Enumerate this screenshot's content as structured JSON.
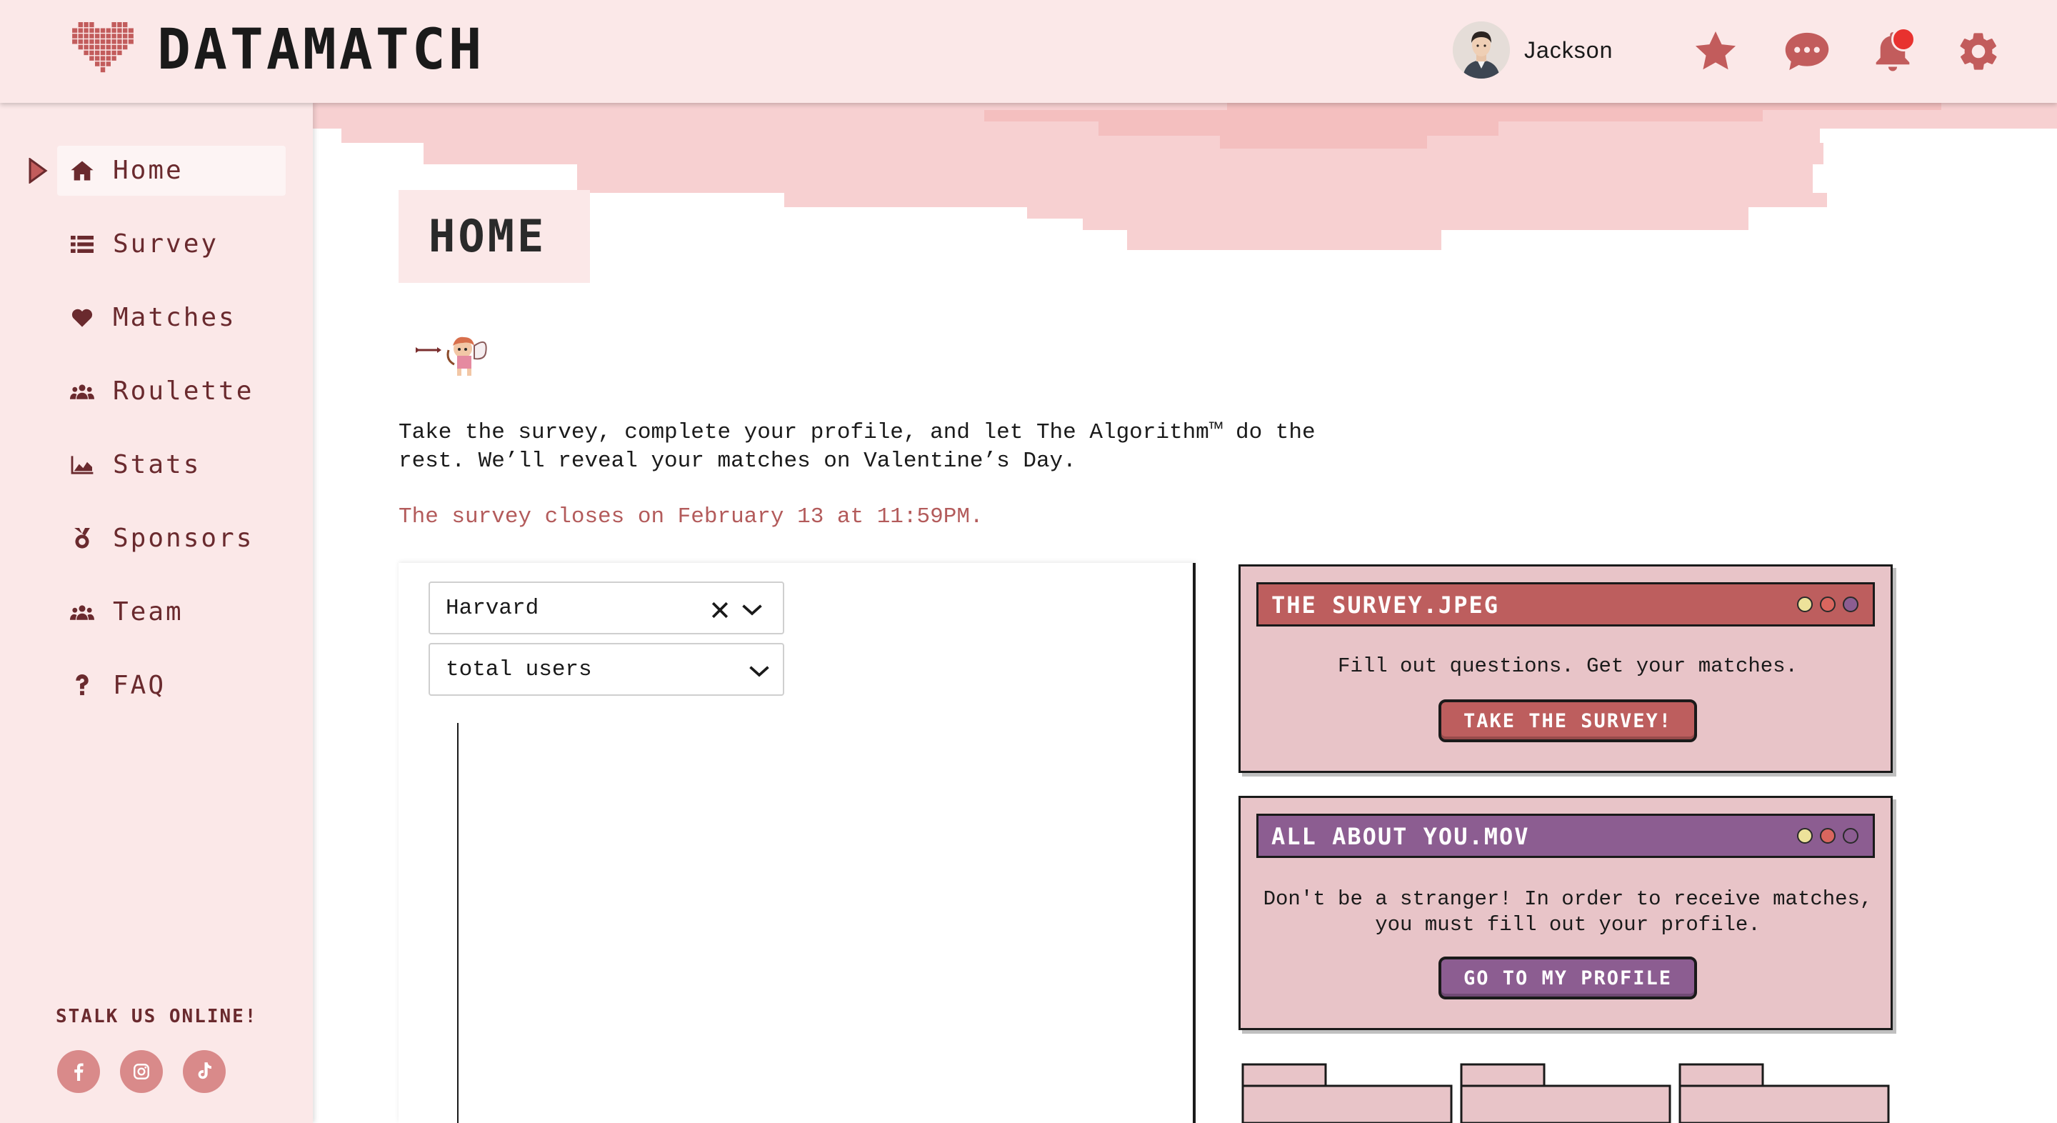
{
  "app": {
    "name": "DATAMATCH"
  },
  "header": {
    "user_name": "Jackson",
    "icons": [
      "star-icon",
      "chat-icon",
      "bell-icon",
      "gear-icon"
    ],
    "has_notification": true
  },
  "sidebar": {
    "items": [
      {
        "label": "Home",
        "icon": "home-icon",
        "active": true
      },
      {
        "label": "Survey",
        "icon": "list-icon",
        "active": false
      },
      {
        "label": "Matches",
        "icon": "heart-icon",
        "active": false
      },
      {
        "label": "Roulette",
        "icon": "users-icon",
        "active": false
      },
      {
        "label": "Stats",
        "icon": "area-chart-icon",
        "active": false
      },
      {
        "label": "Sponsors",
        "icon": "medal-icon",
        "active": false
      },
      {
        "label": "Team",
        "icon": "users-icon",
        "active": false
      },
      {
        "label": "FAQ",
        "icon": "question-icon",
        "active": false
      }
    ],
    "stalk_label": "STALK US ONLINE!",
    "socials": [
      "facebook-icon",
      "instagram-icon",
      "tiktok-icon"
    ]
  },
  "main": {
    "page_title": "HOME",
    "intro_line1": "Take the survey, complete your profile, and let The Algorithm™ do the",
    "intro_line2": "rest. We’ll reveal your matches on Valentine’s Day.",
    "closes_text": "The survey closes on February 13 at 11:59PM.",
    "school_select": {
      "value": "Harvard"
    },
    "metric_select": {
      "value": "total users"
    }
  },
  "windows": [
    {
      "title": "THE SURVEY.JPEG",
      "text": "Fill out questions. Get your matches.",
      "button": "TAKE THE SURVEY!",
      "color": "#bd5e5e"
    },
    {
      "title": "ALL ABOUT YOU.MOV",
      "text_line1": "Don't be a stranger! In order to receive matches,",
      "text_line2": "you must fill out your profile.",
      "button": "GO TO MY PROFILE",
      "color": "#8c5d91"
    }
  ],
  "colors": {
    "accent": "#bd5e5e",
    "sidebar_bg": "#fbe8e8",
    "nav_text": "#6a2a2e",
    "purple": "#8c5d91",
    "window_bg": "#e8c4c8"
  }
}
